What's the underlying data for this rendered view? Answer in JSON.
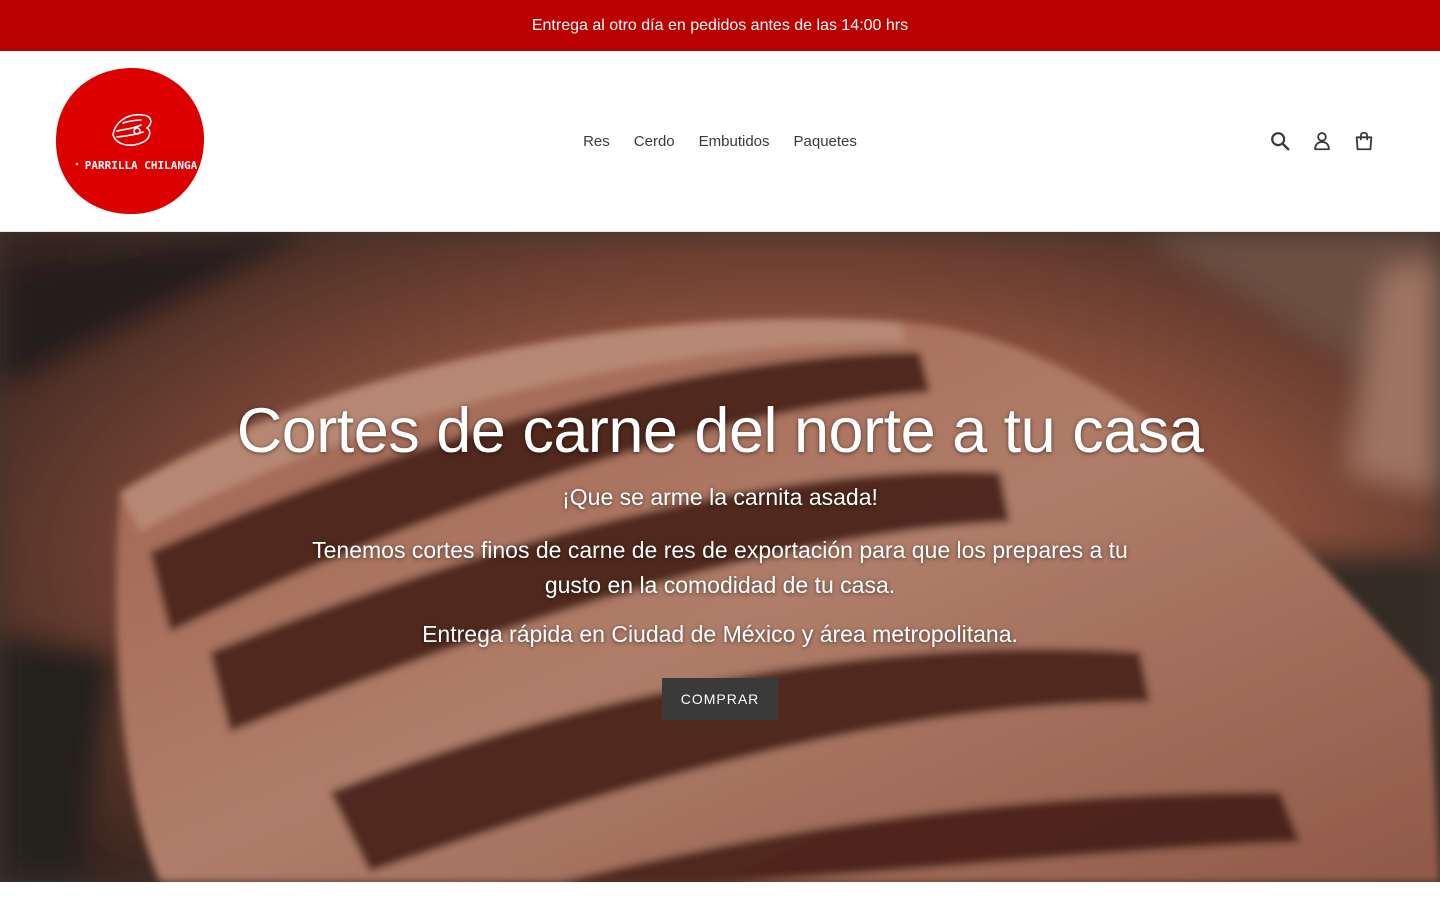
{
  "announcement": {
    "text": "Entrega al otro día en pedidos antes de las 14:00 hrs"
  },
  "header": {
    "logo": {
      "brand_text": "PARRILLA CHILANGA",
      "color": "#dd0000"
    },
    "nav": [
      {
        "label": "Res"
      },
      {
        "label": "Cerdo"
      },
      {
        "label": "Embutidos"
      },
      {
        "label": "Paquetes"
      }
    ],
    "icons": [
      "search-icon",
      "account-icon",
      "cart-icon"
    ]
  },
  "hero": {
    "title": "Cortes de carne del norte a tu casa",
    "subtitle": "¡Que se arme la carnita asada!",
    "paragraph1": "Tenemos cortes finos de carne de res de exportación para que los prepares a tu gusto en la comodidad de tu casa.",
    "paragraph2": "Entrega rápida en Ciudad de México y área metropolitana.",
    "button_label": "COMPRAR"
  },
  "colors": {
    "announcement_bg": "#bb0000",
    "button_bg": "#3a3a3a",
    "text_dark": "#3a3a3a"
  }
}
